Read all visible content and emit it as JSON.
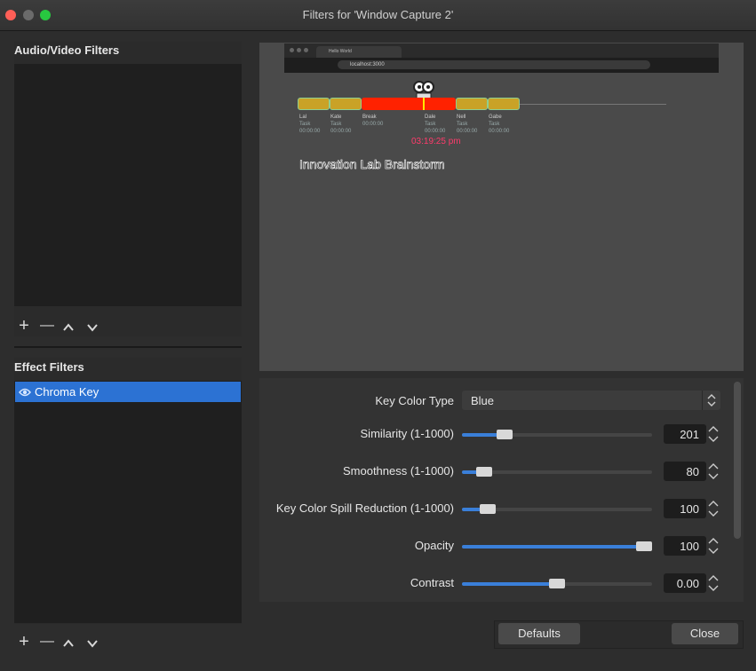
{
  "window": {
    "title": "Filters for 'Window Capture 2'"
  },
  "audio_video": {
    "label": "Audio/Video Filters"
  },
  "effect": {
    "label": "Effect Filters",
    "items": [
      {
        "label": "Chroma Key"
      }
    ]
  },
  "toolbar": {
    "add": "+",
    "remove": "—"
  },
  "preview": {
    "browser_tab": "Hello World",
    "browser_url": "localhost:3000",
    "segments": [
      {
        "name": "Lal",
        "sub": "Task",
        "time": "00:00:00"
      },
      {
        "name": "Kate",
        "sub": "Task",
        "time": "00:00:00"
      },
      {
        "name": "Break",
        "sub": "",
        "time": "00:00:00"
      },
      {
        "name": "Dale",
        "sub": "Task",
        "time": "00:00:00"
      },
      {
        "name": "Nell",
        "sub": "Task",
        "time": "00:00:00"
      },
      {
        "name": "Gabe",
        "sub": "Task",
        "time": "00:00:00"
      }
    ],
    "clock": "03:19:25 pm",
    "title": "Innovation Lab Brainstorm"
  },
  "properties": {
    "key_color_type": {
      "label": "Key Color Type",
      "value": "Blue"
    },
    "similarity": {
      "label": "Similarity (1-1000)",
      "value": "201",
      "level": 0.2
    },
    "smoothness": {
      "label": "Smoothness (1-1000)",
      "value": "80",
      "level": 0.08
    },
    "spill": {
      "label": "Key Color Spill Reduction (1-1000)",
      "value": "100",
      "level": 0.1
    },
    "opacity": {
      "label": "Opacity",
      "value": "100",
      "level": 1.0
    },
    "contrast": {
      "label": "Contrast",
      "value": "0.00",
      "level": 0.5
    }
  },
  "buttons": {
    "defaults": "Defaults",
    "close": "Close"
  },
  "colors": {
    "accent": "#3a7fd9",
    "selection": "#2c72d3",
    "timer": "#ff3b6b",
    "active_segment": "#ff2200",
    "segment": "#c9a227"
  }
}
